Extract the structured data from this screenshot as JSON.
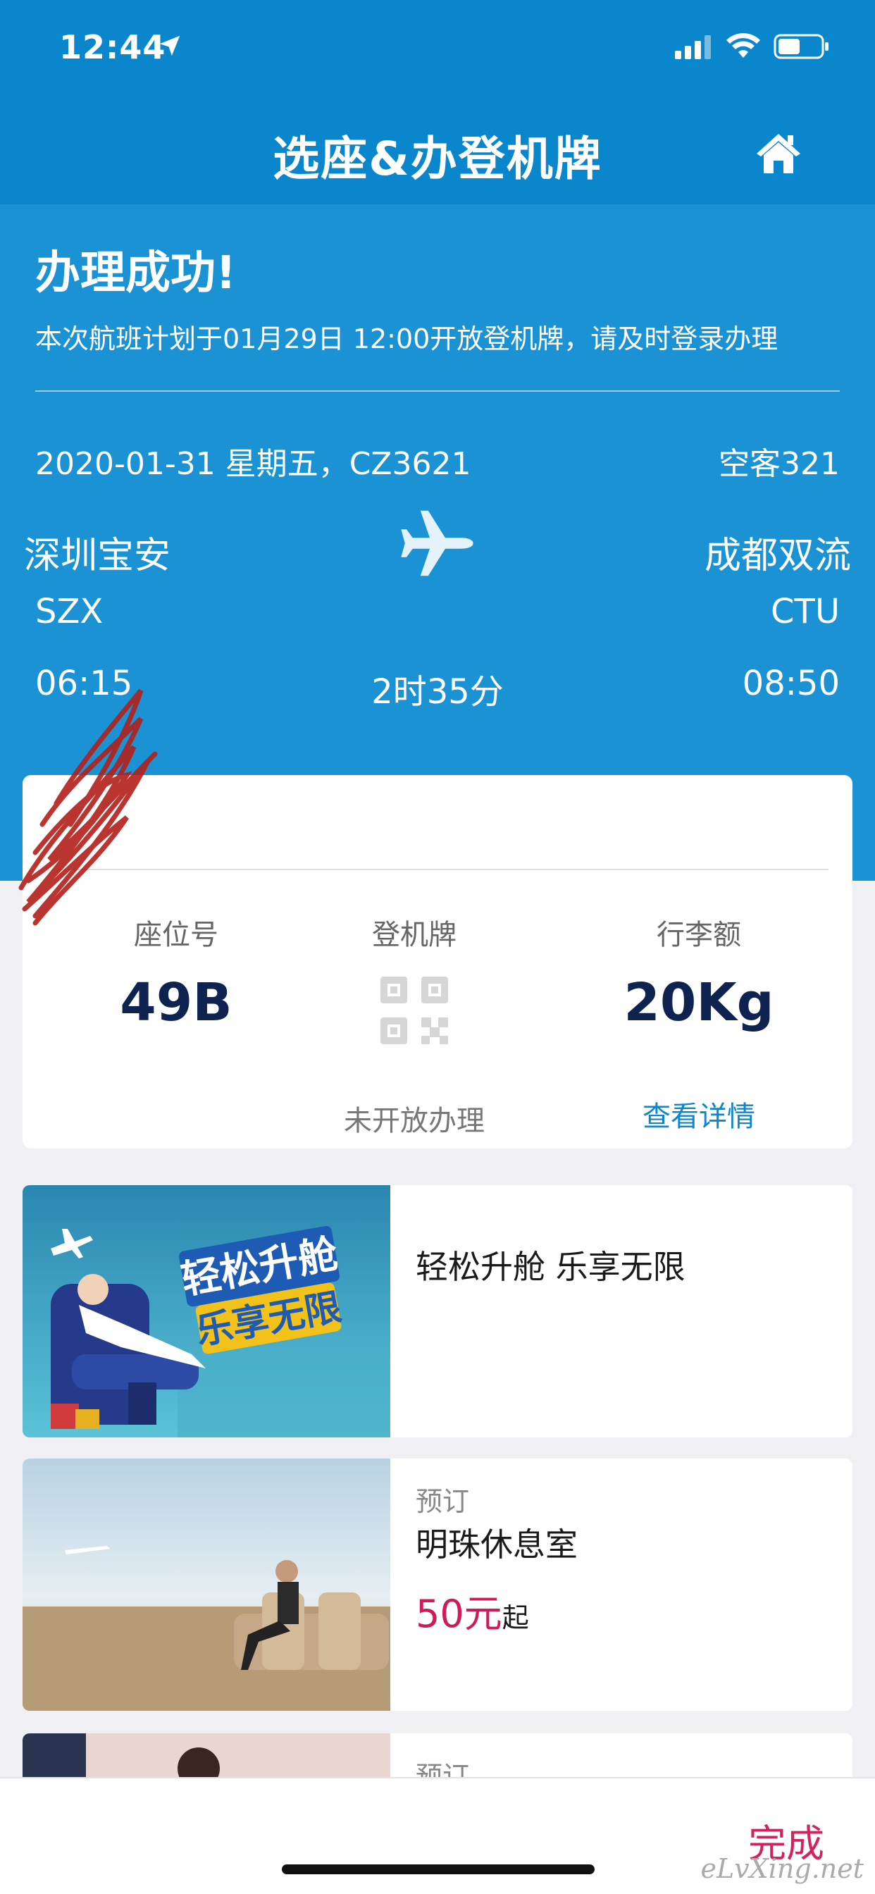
{
  "status_bar": {
    "time": "12:44"
  },
  "nav": {
    "title": "选座&办登机牌"
  },
  "success": {
    "title": "办理成功!",
    "subtitle": "本次航班计划于01月29日 12:00开放登机牌，请及时登录办理"
  },
  "flight": {
    "info": "2020-01-31 星期五，CZ3621",
    "aircraft": "空客321",
    "departure": {
      "city": "深圳宝安",
      "code": "SZX",
      "time": "06:15"
    },
    "arrival": {
      "city": "成都双流",
      "code": "CTU",
      "time": "08:50"
    },
    "duration": "2时35分"
  },
  "checkin_card": {
    "seat_label": "座位号",
    "seat_value": "49B",
    "boarding_label": "登机牌",
    "boarding_status": "未开放办理",
    "baggage_label": "行李额",
    "baggage_value": "20Kg",
    "details_link": "查看详情"
  },
  "promos": [
    {
      "image_text_1": "轻松升舱",
      "image_text_2": "乐享无限",
      "title": "轻松升舱 乐享无限"
    },
    {
      "label": "预订",
      "title": "明珠休息室",
      "price": "50元",
      "price_suffix": "起"
    },
    {
      "label": "预订"
    }
  ],
  "bottom_bar": {
    "done_label": "完成"
  },
  "watermark": "eLvXing.net",
  "colors": {
    "header_blue": "#0a86cc",
    "body_blue": "#1a92d3",
    "accent_red": "#d2225f",
    "link_blue": "#0f86c9"
  }
}
